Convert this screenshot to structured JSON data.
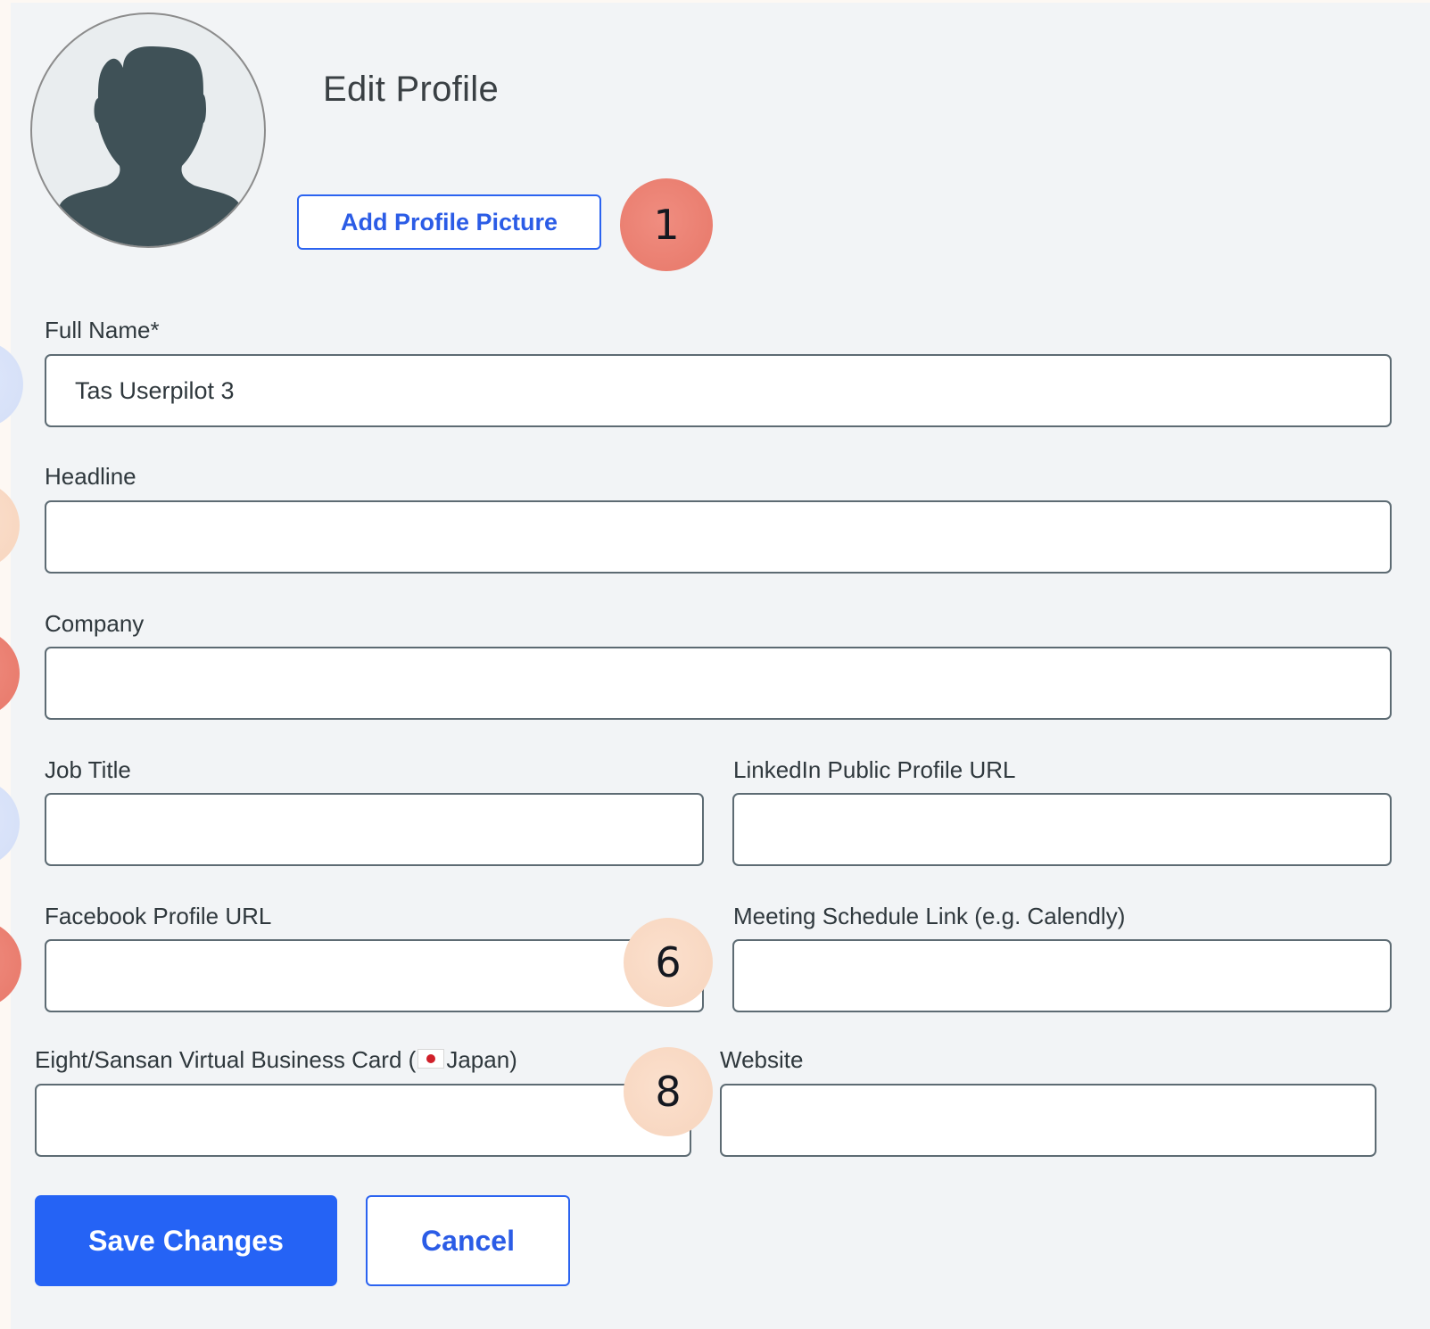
{
  "page": {
    "title": "Edit Profile",
    "add_picture_label": "Add Profile Picture"
  },
  "fields": {
    "full_name": {
      "label": "Full Name*",
      "value": "Tas Userpilot 3"
    },
    "headline": {
      "label": "Headline",
      "value": ""
    },
    "company": {
      "label": "Company",
      "value": ""
    },
    "job_title": {
      "label": "Job Title",
      "value": ""
    },
    "linkedin": {
      "label": "LinkedIn Public Profile URL",
      "value": ""
    },
    "facebook": {
      "label": "Facebook Profile URL",
      "value": ""
    },
    "meeting": {
      "label": "Meeting Schedule Link (e.g. Calendly)",
      "value": ""
    },
    "eight": {
      "label_prefix": "Eight/Sansan Virtual Business Card (",
      "label_suffix": "Japan)",
      "value": ""
    },
    "website": {
      "label": "Website",
      "value": ""
    }
  },
  "markers": {
    "m1": "1",
    "m6": "6",
    "m8": "8"
  },
  "actions": {
    "save_label": "Save Changes",
    "cancel_label": "Cancel"
  },
  "colors": {
    "primary": "#2563f5",
    "marker_red": "#e97a6c",
    "marker_peach": "#f9dac6",
    "marker_blue": "#d9e2f9"
  }
}
